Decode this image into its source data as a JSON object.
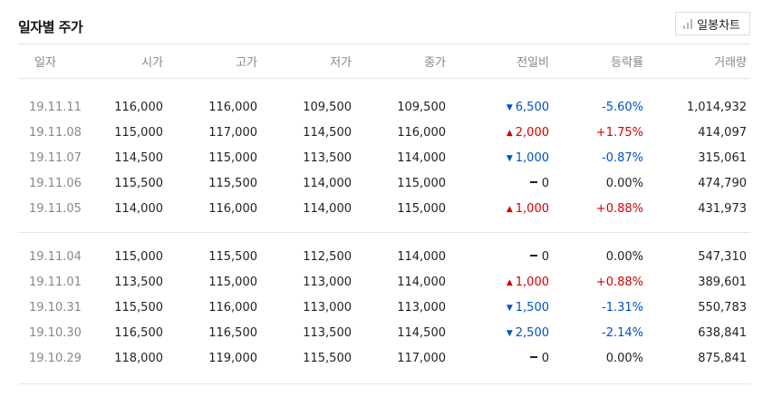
{
  "section": {
    "title": "일자별 주가",
    "chart_button_label": "일봉차트"
  },
  "columns": [
    "일자",
    "시가",
    "고가",
    "저가",
    "종가",
    "전일비",
    "등락률",
    "거래량"
  ],
  "group1": [
    {
      "date": "19.11.11",
      "open": "116,000",
      "high": "116,000",
      "low": "109,500",
      "close": "109,500",
      "dir": "down",
      "change": "6,500",
      "rate": "-5.60%",
      "volume": "1,014,932"
    },
    {
      "date": "19.11.08",
      "open": "115,000",
      "high": "117,000",
      "low": "114,500",
      "close": "116,000",
      "dir": "up",
      "change": "2,000",
      "rate": "+1.75%",
      "volume": "414,097"
    },
    {
      "date": "19.11.07",
      "open": "114,500",
      "high": "115,000",
      "low": "113,500",
      "close": "114,000",
      "dir": "down",
      "change": "1,000",
      "rate": "-0.87%",
      "volume": "315,061"
    },
    {
      "date": "19.11.06",
      "open": "115,500",
      "high": "115,500",
      "low": "114,000",
      "close": "115,000",
      "dir": "flat",
      "change": "0",
      "rate": "0.00%",
      "volume": "474,790"
    },
    {
      "date": "19.11.05",
      "open": "114,000",
      "high": "116,000",
      "low": "114,000",
      "close": "115,000",
      "dir": "up",
      "change": "1,000",
      "rate": "+0.88%",
      "volume": "431,973"
    }
  ],
  "group2": [
    {
      "date": "19.11.04",
      "open": "115,000",
      "high": "115,500",
      "low": "112,500",
      "close": "114,000",
      "dir": "flat",
      "change": "0",
      "rate": "0.00%",
      "volume": "547,310"
    },
    {
      "date": "19.11.01",
      "open": "113,500",
      "high": "115,000",
      "low": "113,000",
      "close": "114,000",
      "dir": "up",
      "change": "1,000",
      "rate": "+0.88%",
      "volume": "389,601"
    },
    {
      "date": "19.10.31",
      "open": "115,500",
      "high": "116,000",
      "low": "113,000",
      "close": "113,000",
      "dir": "down",
      "change": "1,500",
      "rate": "-1.31%",
      "volume": "550,783"
    },
    {
      "date": "19.10.30",
      "open": "116,500",
      "high": "116,500",
      "low": "113,500",
      "close": "114,500",
      "dir": "down",
      "change": "2,500",
      "rate": "-2.14%",
      "volume": "638,841"
    },
    {
      "date": "19.10.29",
      "open": "118,000",
      "high": "119,000",
      "low": "115,500",
      "close": "117,000",
      "dir": "flat",
      "change": "0",
      "rate": "0.00%",
      "volume": "875,841"
    }
  ],
  "colors": {
    "up": "#d60000",
    "down": "#0051c7",
    "flat": "#222222"
  }
}
